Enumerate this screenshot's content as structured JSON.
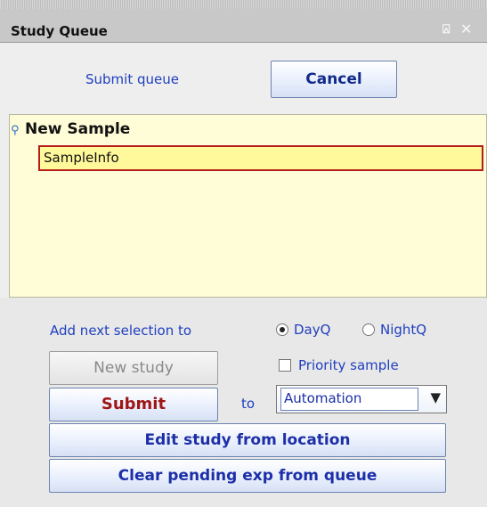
{
  "titlebar": {
    "title": "Study Queue",
    "pin_icon": "⍓",
    "close_icon": "✕"
  },
  "top": {
    "submit_queue_label": "Submit queue",
    "cancel_label": "Cancel"
  },
  "queue": {
    "node_icon": "⚲",
    "node_label": "New Sample",
    "sample_field_value": "SampleInfo"
  },
  "controls": {
    "add_next_label": "Add next selection to",
    "radio_day_label": "DayQ",
    "radio_night_label": "NightQ",
    "radio_selected": "DayQ",
    "new_study_label": "New study",
    "priority_label": "Priority sample",
    "priority_checked": false,
    "submit_label": "Submit",
    "to_label": "to",
    "target_value": "Automation",
    "dropdown_arrow": "▼",
    "edit_study_label": "Edit study from location",
    "clear_pending_label": "Clear pending exp from queue"
  },
  "colors": {
    "label_blue": "#1f3fbf",
    "submit_red": "#a01515",
    "queue_bg": "#fffdd7",
    "sample_field_bg": "#fff99b",
    "sample_field_border": "#b51d1d"
  }
}
